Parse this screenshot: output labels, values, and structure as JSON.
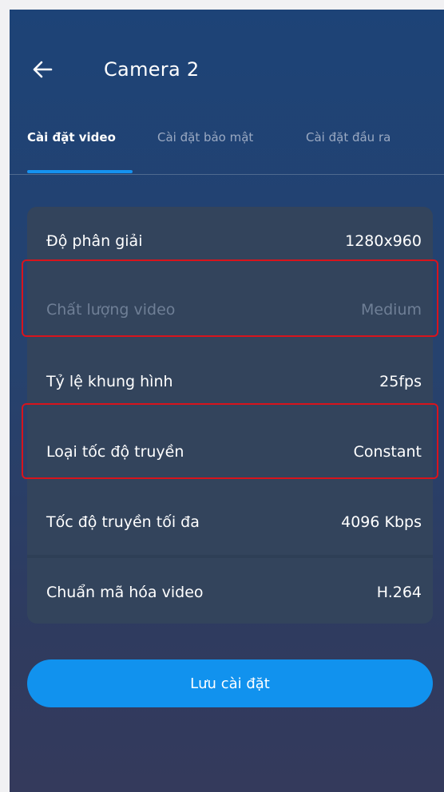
{
  "header": {
    "title": "Camera 2",
    "back_icon": "arrow-left-icon"
  },
  "tabs": [
    {
      "label": "Cài đặt video",
      "active": true
    },
    {
      "label": "Cài đặt bảo mật",
      "active": false
    },
    {
      "label": "Cài đặt đầu ra",
      "active": false
    }
  ],
  "settings": [
    {
      "label": "Độ phân giải",
      "value": "1280x960",
      "disabled": false,
      "highlighted": false
    },
    {
      "label": "Chất lượng video",
      "value": "Medium",
      "disabled": true,
      "highlighted": true
    },
    {
      "label": "Tỷ lệ khung hình",
      "value": "25fps",
      "disabled": false,
      "highlighted": false
    },
    {
      "label": "Loại tốc độ truyền",
      "value": "Constant",
      "disabled": false,
      "highlighted": true
    },
    {
      "label": "Tốc độ truyền tối đa",
      "value": "4096 Kbps",
      "disabled": false,
      "highlighted": false
    },
    {
      "label": "Chuẩn mã hóa video",
      "value": "H.264",
      "disabled": false,
      "highlighted": false
    }
  ],
  "save_button": {
    "label": "Lưu cài đặt"
  },
  "colors": {
    "accent": "#1192ee",
    "highlight_border": "#d8141c",
    "card_bg": "#33445c"
  }
}
